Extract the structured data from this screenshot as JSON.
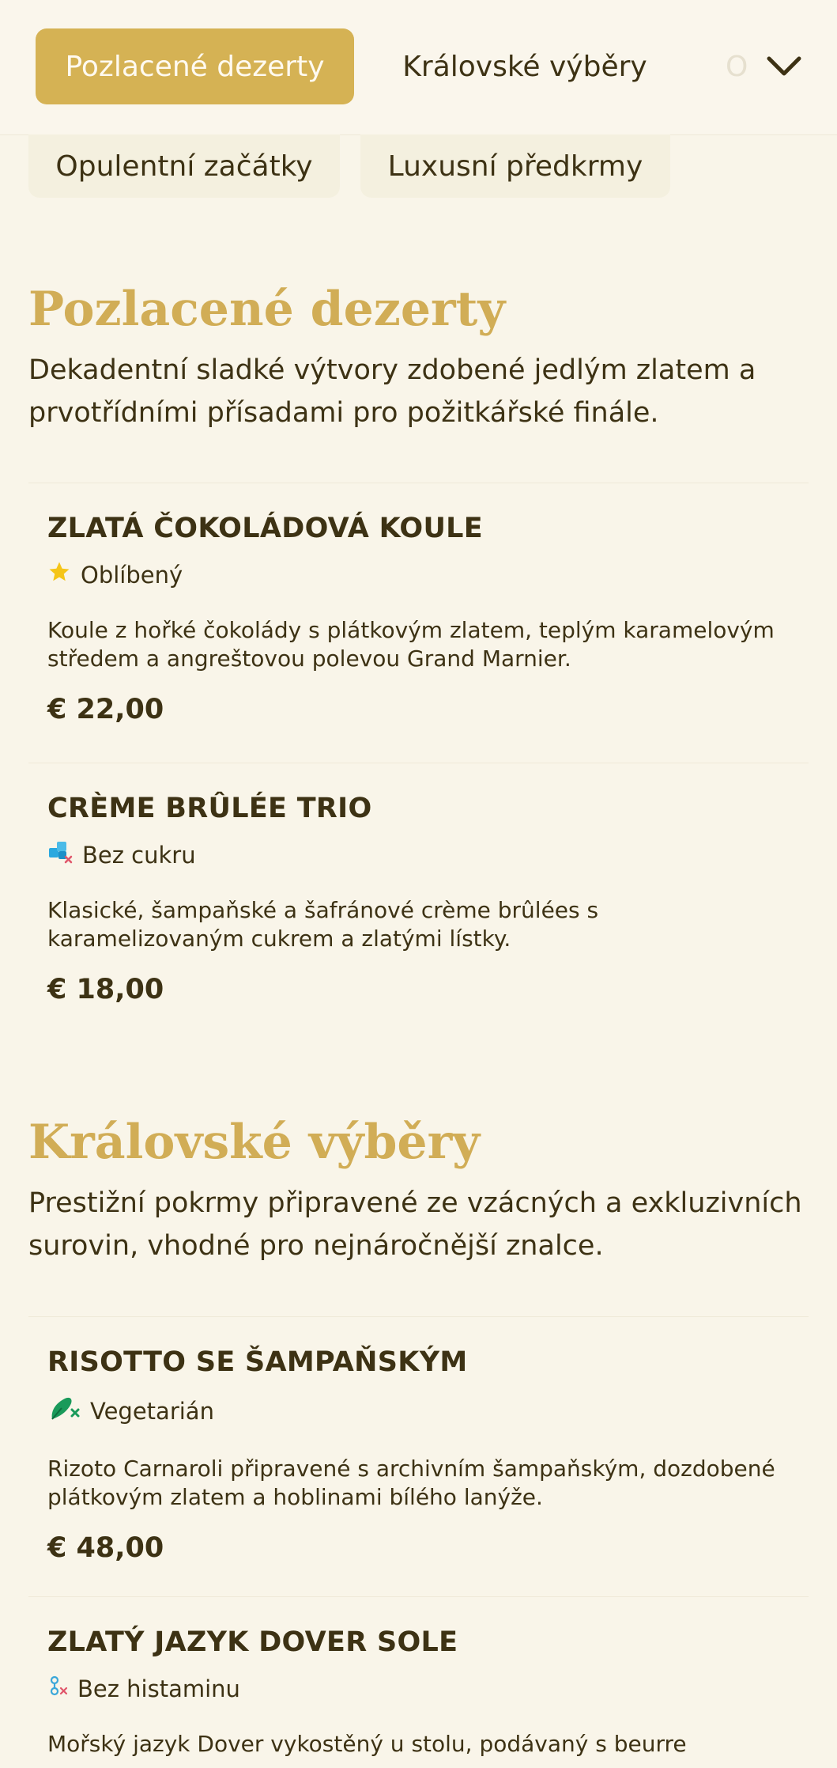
{
  "nav": {
    "tabs": [
      "Pozlacené dezerty",
      "Královské výběry",
      "O"
    ],
    "tabs_row2": [
      "Opulentní začátky",
      "Luxusní předkrmy"
    ],
    "expand_icon": "chevron-down-icon"
  },
  "sections": [
    {
      "title": "Pozlacené dezerty",
      "description": "Dekadentní sladké výtvory zdobené jedlým zlatem a prvotřídními přísadami pro požitkářské finále.",
      "items": [
        {
          "name": "ZLATÁ ČOKOLÁDOVÁ KOULE",
          "tag": "Oblíbený",
          "tag_icon": "star-icon",
          "description": "Koule z hořké čokolády s plátkovým zlatem, teplým karamelovým středem a angreštovou polevou Grand Marnier.",
          "price": "€ 22,00"
        },
        {
          "name": "CRÈME BRÛLÉE TRIO",
          "tag": "Bez cukru",
          "tag_icon": "sugar-free-icon",
          "description": "Klasické, šampaňské a šafránové crème brûlées s karamelizovaným cukrem a zlatými lístky.",
          "price": "€ 18,00"
        }
      ]
    },
    {
      "title": "Královské výběry",
      "description": "Prestižní pokrmy připravené ze vzácných a exkluzivních surovin, vhodné pro nejnáročnější znalce.",
      "items": [
        {
          "name": "RISOTTO SE ŠAMPAŇSKÝM",
          "tag": "Vegetarián",
          "tag_icon": "vegetarian-icon",
          "description": "Rizoto Carnaroli připravené s archivním šampaňským, dozdobené plátkovým zlatem a hoblinami bílého lanýže.",
          "price": "€ 48,00"
        },
        {
          "name": "ZLATÝ JAZYK DOVER SOLE",
          "tag": "Bez histaminu",
          "tag_icon": "histamine-free-icon",
          "description": "Mořský jazyk Dover vykostěný u stolu, podávaný s beurre"
        }
      ]
    }
  ],
  "colors": {
    "background": "#f9f5e9",
    "accent_gold": "#d5b254",
    "heading_gold": "#d1ad56",
    "text": "#3d3214",
    "star": "#f5c518",
    "sugar_free": "#2aa8df",
    "vegetarian": "#1a9a5a",
    "histamine_free": "#3aa7d9"
  }
}
